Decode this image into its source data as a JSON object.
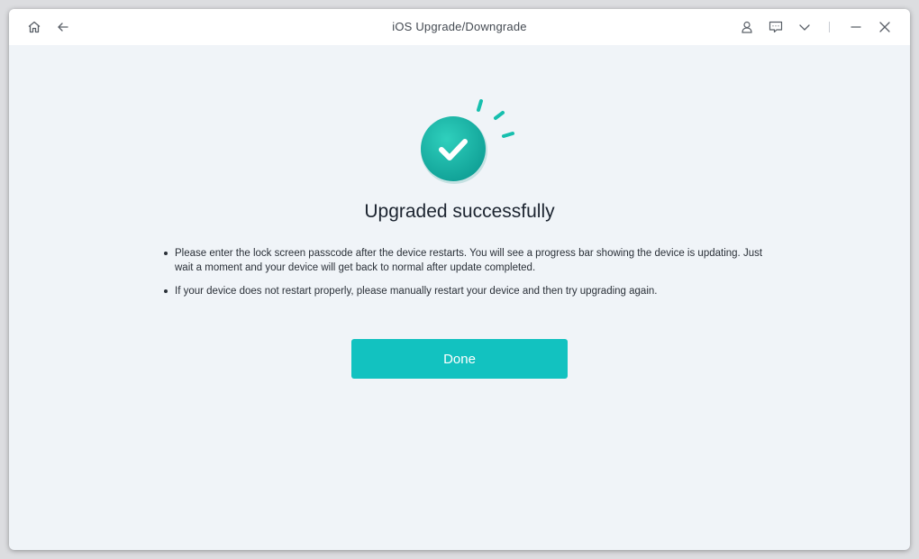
{
  "window": {
    "title": "iOS Upgrade/Downgrade"
  },
  "toolbar": {
    "home_icon": "home-icon",
    "back_icon": "arrow-left-icon",
    "user_icon": "user-icon",
    "feedback_icon": "chat-icon",
    "menu_icon": "chevron-down-icon",
    "minimize_icon": "minimize-icon",
    "close_icon": "close-icon"
  },
  "main": {
    "status_icon": "success-check-icon",
    "headline": "Upgraded successfully",
    "notes": [
      "Please enter the lock screen passcode after the device restarts. You will see a progress bar showing the device is updating. Just wait a moment and your device will get back to normal after update completed.",
      "If your device does not restart properly, please manually restart your device and then try upgrading again."
    ],
    "done_label": "Done"
  },
  "colors": {
    "accent": "#12c2c0",
    "check_circle": "#1fb8a8",
    "background": "#f0f4f8",
    "titlebar": "#ffffff"
  }
}
